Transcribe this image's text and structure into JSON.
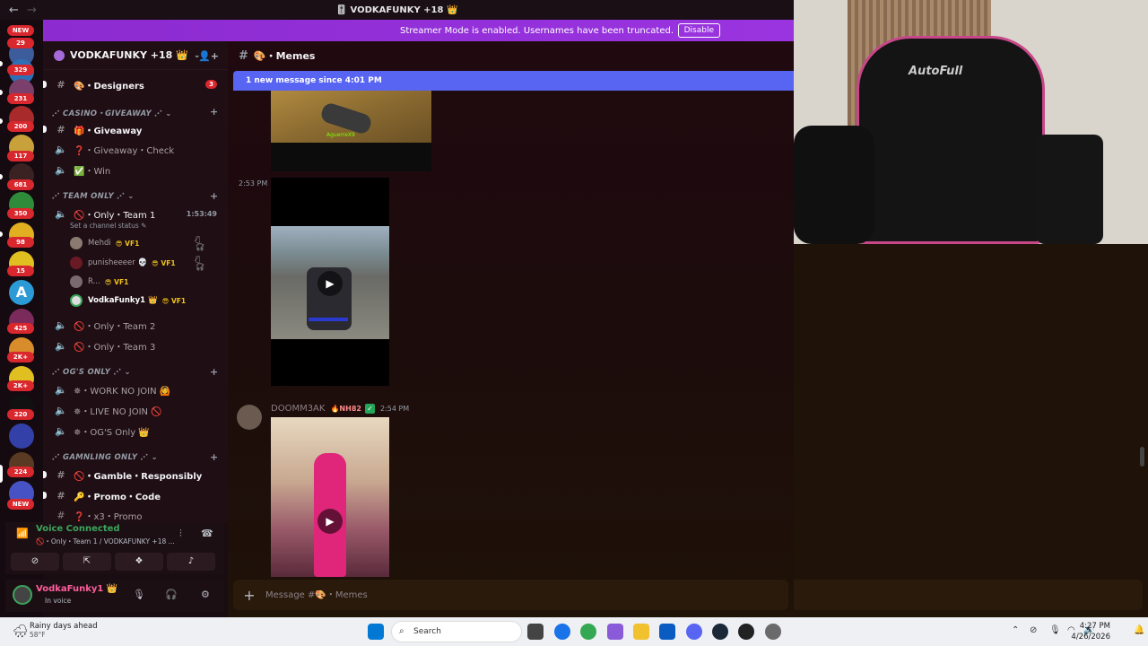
{
  "window": {
    "title": "🎚️ VODKAFUNKY +18 👑",
    "back": "←",
    "forward": "→"
  },
  "banner": {
    "text": "Streamer Mode is enabled. Usernames have been truncated.",
    "button": "Disable"
  },
  "rail": {
    "badges": [
      "NEW",
      "29",
      "329",
      "231",
      "200",
      "117",
      "681",
      "350",
      "98",
      "15",
      "425",
      "2K+",
      "2K+",
      "220",
      "224",
      "NEW"
    ]
  },
  "server": {
    "name": "VODKAFUNKY +18 👑",
    "invite_icon": "add-user-icon"
  },
  "channels": {
    "designers": {
      "label": "🎨・Designers",
      "mention": "3"
    },
    "cat_casino": "⋰ CASINO・GIVEAWAY ⋰",
    "giveaway": "🎁・Giveaway",
    "giveaway_check": "❓・Giveaway・Check",
    "win": "✅・Win",
    "cat_team": "⋰ TEAM ONLY ⋰",
    "team1": {
      "label": "🚫・Only・Team 1",
      "time": "1:53:49",
      "status": "Set a channel status ✎"
    },
    "team_users": [
      {
        "name": "Mehdi",
        "tag": "😎 VF1"
      },
      {
        "name": "punisheeeer 💀",
        "tag": "😎 VF1"
      },
      {
        "name": "R...",
        "tag": "😎 VF1"
      },
      {
        "name": "VodkaFunky1 👑",
        "tag": "😎 VF1"
      }
    ],
    "team2": "🚫・Only・Team 2",
    "team3": "🚫・Only・Team 3",
    "cat_og": "⋰ OG'S ONLY ⋰",
    "work": "✵・WORK NO JOIN 🙆",
    "live": "✵・LIVE NO JOIN 🚫",
    "ogs": "✵・OG'S Only 👑",
    "cat_gambling": "⋰ GAMNLING ONLY ⋰",
    "gamble": "🚫・Gamble・Responsibly",
    "promo": "🔑・Promo・Code",
    "x3": "❓・x3・Promo"
  },
  "voice": {
    "status": "Voice Connected",
    "sub": "🚫・Only・Team 1 / VODKAFUNKY +18 ...",
    "controls": [
      "camera-off-icon",
      "screen-share-icon",
      "activities-icon",
      "soundboard-icon"
    ]
  },
  "user": {
    "name": "VodkaFunky1 👑",
    "status": "In voice"
  },
  "chat": {
    "channel": "🎨・Memes",
    "new_messages": "1 new message since 4:01 PM",
    "t1": "2:53 PM",
    "author": "DOOMM3AK",
    "author_badge": "🔥NH82",
    "author_time": "2:54 PM",
    "video_tag": "[ ◇ ]",
    "gamer_tag": "AguerreX9",
    "composer_placeholder": "Message #🎨・Memes"
  },
  "cam": {
    "brand": "AutoFull"
  },
  "taskbar": {
    "weather_title": "Rainy days ahead",
    "weather_temp": "58°F",
    "search": "Search",
    "time": "4:27 PM",
    "date": "4/26/2026"
  },
  "colors": {
    "accent": "#5865f2",
    "banner": "#9a34e0",
    "voice": "#3ba55c",
    "mention": "#d9272e"
  }
}
